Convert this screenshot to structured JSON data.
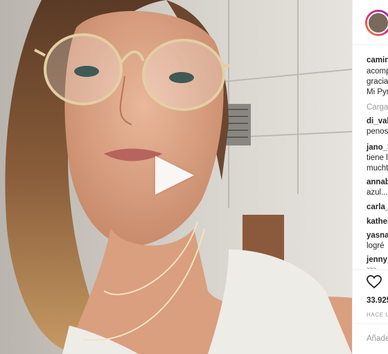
{
  "post": {
    "caption_lines": [
      "camin",
      "acomp",
      "gracia",
      "Mi Pyr"
    ],
    "load_more": "Carga"
  },
  "comments": [
    {
      "user": "di_val",
      "text": "penos"
    },
    {
      "user": "jano_3",
      "text_lines": [
        "tiene l",
        "mucht"
      ]
    },
    {
      "user": "annab",
      "text": "azul..."
    },
    {
      "user": "carla_",
      "text": ""
    },
    {
      "user": "kather",
      "text": ""
    },
    {
      "user": "yasna",
      "text": "logré"
    },
    {
      "user": "jenny_",
      "text": "~~~"
    }
  ],
  "stats": {
    "views": "33.925",
    "time": "HACE U"
  },
  "add_comment": {
    "placeholder": "Añade"
  },
  "icons": {
    "like": "heart-icon",
    "play": "play-icon"
  }
}
